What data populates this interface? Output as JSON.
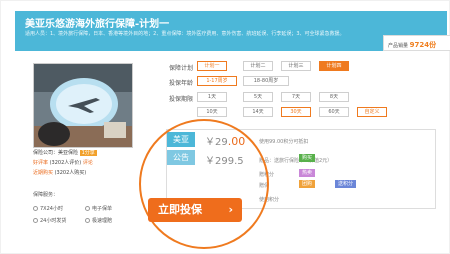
{
  "banner": {
    "title": "美亚乐悠游海外旅行保障-计划一",
    "description": "适用人员：1、境外旅行保障，日本、香港等境外目的地；2、重点保障：境外医疗费用、意外伤害、航班延误、行李延误；3、可全球紧急救援。",
    "sales_label": "产品销量",
    "sales_value": "9724份"
  },
  "photo": {
    "alt_icon": "airplane-photo"
  },
  "info": {
    "company": "保险公司：美亚保险",
    "company_badge": "1分享",
    "rating": "好评率",
    "rating_count": "(3202人评价)",
    "rating_link": "评论",
    "faq": "近期购买",
    "faq_count": "(3202人购买)"
  },
  "form": {
    "plan_label": "保障计划",
    "plans": [
      "计划一",
      "计划二",
      "计划三",
      "计划四"
    ],
    "age_label": "投保年龄",
    "ages": [
      "1-17周岁",
      "18-80周岁"
    ],
    "period_label": "投保期限",
    "periods_row1": [
      "1天",
      "5天",
      "7天",
      "8天"
    ],
    "periods_row2": [
      "10天",
      "14天",
      "30天",
      "60天",
      "自定义"
    ]
  },
  "prices": {
    "tag_main": "美亚",
    "price_main_prefix": "￥29",
    "price_main_suffix": ".00",
    "tag_second": "公告",
    "price_second": "￥299.5",
    "note1": "使用99.00积分可抵扣",
    "note2": "赠品：送旅行保险卡（价值2元）",
    "note3": "赠积分",
    "note4": "赠保",
    "note5": "使用积分",
    "chip1": "购买",
    "chip2": "热卖",
    "chip3": "团购",
    "chip4": "送积分"
  },
  "buy": {
    "label": "立即投保",
    "arrow": "›"
  },
  "guarantee": {
    "title": "保障服务：",
    "items": [
      "7X24小时",
      "电子保单",
      "24小时发货",
      "极速理赔"
    ]
  },
  "colors": {
    "accent": "#ef6d1c",
    "banner": "#4cb7d8"
  }
}
